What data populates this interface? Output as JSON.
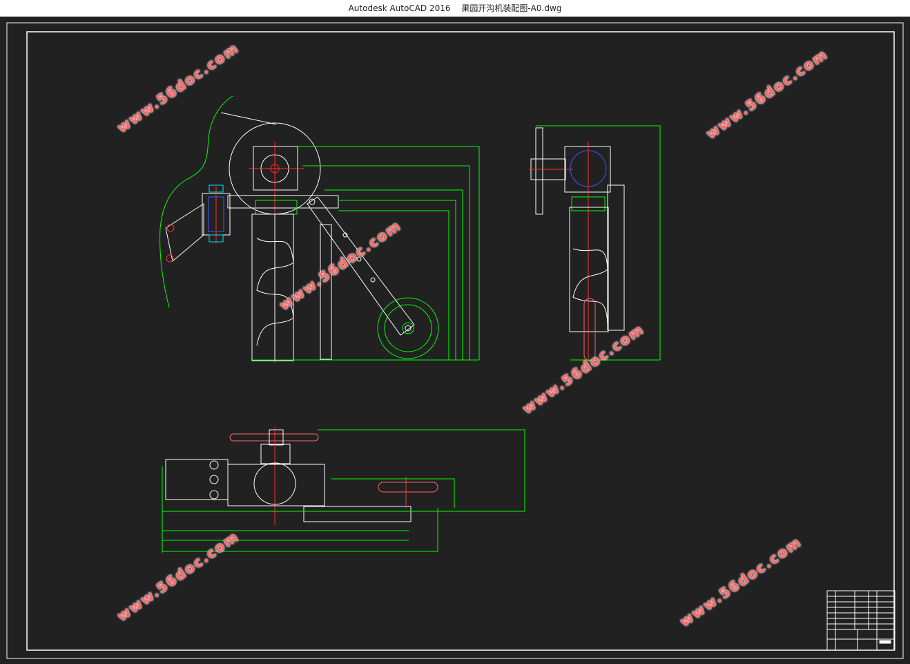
{
  "window": {
    "app_title": "Autodesk AutoCAD 2016",
    "file_name": "果园开沟机装配图-A0.dwg"
  },
  "colors": {
    "background": "#212121",
    "line_white": "#ffffff",
    "line_green": "#00ff00",
    "line_red": "#ff3030",
    "line_blue": "#3a5cff",
    "line_cyan": "#00e5ff",
    "watermark": "#ff6666"
  },
  "watermarks": [
    {
      "text": "www.56doc.com"
    },
    {
      "text": "www.56doc.com"
    },
    {
      "text": "www.56doc.com"
    },
    {
      "text": "www.56doc.com"
    },
    {
      "text": "www.56doc.com"
    },
    {
      "text": "www.56doc.com"
    },
    {
      "text": "www.56doc.com"
    }
  ],
  "drawing": {
    "views": [
      "front-view",
      "side-view",
      "top-view"
    ],
    "title_block": "title-block"
  }
}
